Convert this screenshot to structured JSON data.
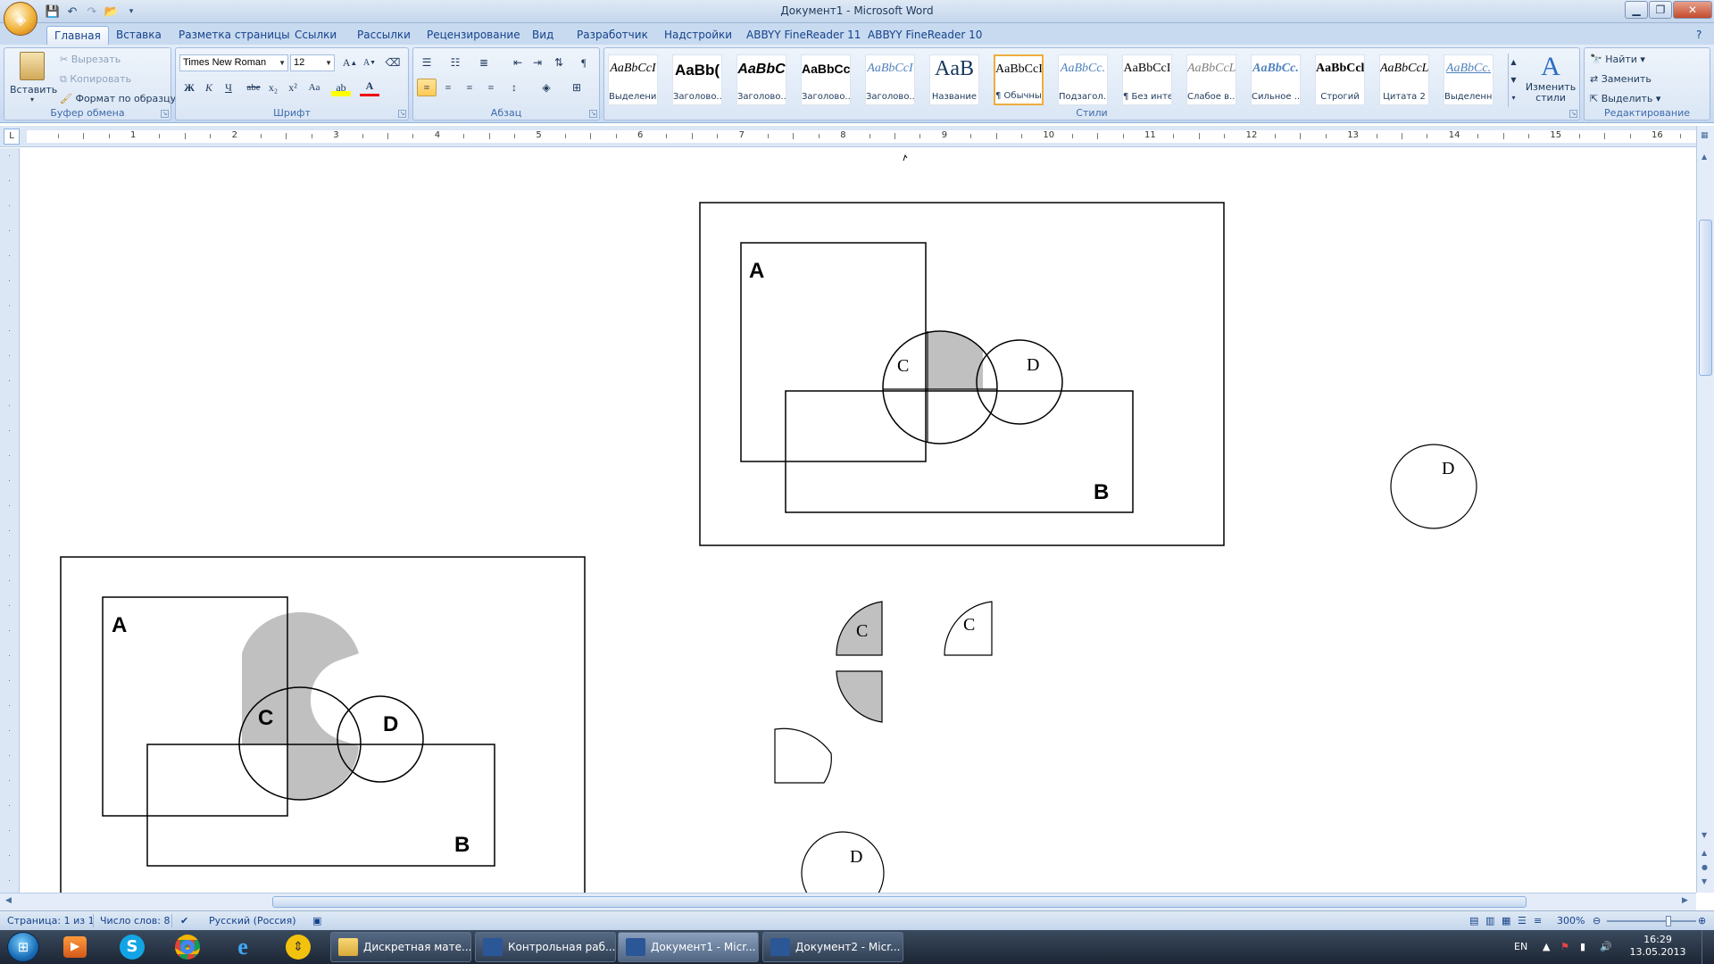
{
  "window": {
    "title": "Документ1 - Microsoft Word"
  },
  "tabs": [
    "Главная",
    "Вставка",
    "Разметка страницы",
    "Ссылки",
    "Рассылки",
    "Рецензирование",
    "Вид",
    "Разработчик",
    "Надстройки",
    "ABBYY FineReader 11",
    "ABBYY FineReader 10"
  ],
  "clipboard": {
    "paste": "Вставить",
    "cut": "Вырезать",
    "copy": "Копировать",
    "format_painter": "Формат по образцу",
    "label": "Буфер обмена"
  },
  "font": {
    "name": "Times New Roman",
    "size": "12",
    "label": "Шрифт",
    "bold": "Ж",
    "italic": "К",
    "underline": "Ч",
    "strike": "abe",
    "sub": "x₂",
    "sup": "x²",
    "case": "Aa",
    "color_a": "A"
  },
  "paragraph": {
    "label": "Абзац"
  },
  "styles": {
    "label": "Стили",
    "items": [
      {
        "sample": "AaBbCcI",
        "name": "Выделение"
      },
      {
        "sample": "AaBb(",
        "name": "Заголово..."
      },
      {
        "sample": "AaBbC",
        "name": "Заголово..."
      },
      {
        "sample": "AaBbCc",
        "name": "Заголово..."
      },
      {
        "sample": "AaBbCcI",
        "name": "Заголово..."
      },
      {
        "sample": "AaB",
        "name": "Название"
      },
      {
        "sample": "AaBbCcI",
        "name": "¶ Обычный"
      },
      {
        "sample": "AaBbCc.",
        "name": "Подзагол..."
      },
      {
        "sample": "AaBbCcI",
        "name": "¶ Без инте..."
      },
      {
        "sample": "AaBbCcL",
        "name": "Слабое в..."
      },
      {
        "sample": "AaBbCc.",
        "name": "Сильное ..."
      },
      {
        "sample": "AaBbCcl",
        "name": "Строгий"
      },
      {
        "sample": "AaBbCcL",
        "name": "Цитата 2"
      },
      {
        "sample": "AaBbCc.",
        "name": "Выделенн..."
      }
    ],
    "change_styles": "Изменить стили"
  },
  "editing": {
    "find": "Найти",
    "replace": "Заменить",
    "select": "Выделить",
    "label": "Редактирование"
  },
  "ruler": {
    "numbers": [
      "1",
      "2",
      "3",
      "4",
      "5",
      "6",
      "7",
      "8",
      "9",
      "10",
      "11",
      "12",
      "13",
      "14",
      "15",
      "16"
    ]
  },
  "diagram_top": {
    "a": "A",
    "b": "B",
    "c": "C",
    "d": "D"
  },
  "diagram_bottom": {
    "a": "A",
    "b": "B",
    "c": "C",
    "d": "D"
  },
  "loose_shapes": {
    "d1": "D",
    "c1": "C",
    "c2": "C",
    "d2": "D"
  },
  "status": {
    "page": "Страница: 1 из 1",
    "words": "Число слов: 8",
    "lang": "Русский (Россия)",
    "zoom": "300%"
  },
  "taskbar": {
    "tasks": [
      "Дискретная мате...",
      "Контрольная раб...",
      "Документ1 - Micr...",
      "Документ2 - Micr..."
    ],
    "lang": "EN",
    "time": "16:29",
    "date": "13.05.2013"
  },
  "colors": {
    "accent": "#15428b",
    "shade": "#c0c0c0",
    "selected_style": "#f0ad3d"
  }
}
